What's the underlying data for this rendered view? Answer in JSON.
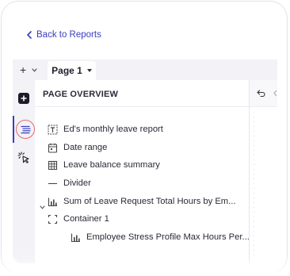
{
  "header": {
    "back_label": "Back to Reports"
  },
  "toolbar": {
    "add_symbol": "+",
    "page_tab_label": "Page 1"
  },
  "rail": {
    "items": [
      {
        "icon": "add-element-icon"
      },
      {
        "icon": "page-overview-icon",
        "active": true
      },
      {
        "icon": "interactions-cursor-icon"
      }
    ]
  },
  "panel": {
    "title": "PAGE OVERVIEW",
    "items": [
      {
        "label": "Ed's monthly leave report",
        "icon": "text-element-icon"
      },
      {
        "label": "Date range",
        "icon": "calendar-icon"
      },
      {
        "label": "Leave balance summary",
        "icon": "table-icon"
      },
      {
        "label": "Divider",
        "icon": "divider-icon"
      },
      {
        "label": "Sum of Leave Request Total Hours by Em...",
        "icon": "bar-chart-icon"
      },
      {
        "label": "Container 1",
        "icon": "container-icon",
        "expanded": true
      },
      {
        "label": "Employee Stress Profile Max Hours Per...",
        "icon": "bar-chart-icon",
        "child_of": "Container 1"
      }
    ]
  },
  "colors": {
    "accent": "#3b3dbf",
    "highlight_ring": "#e86a6a",
    "rail_bg": "#f2f2f7",
    "dark_button": "#1b1b2a"
  }
}
